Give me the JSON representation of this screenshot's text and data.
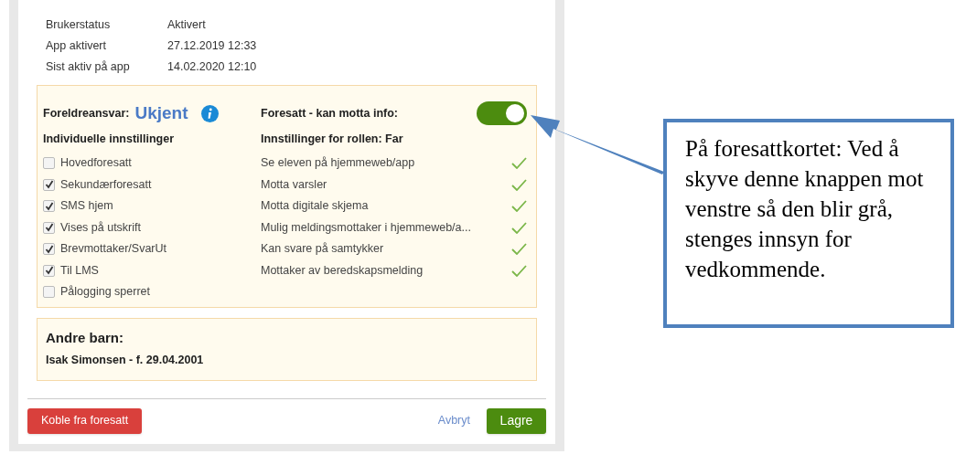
{
  "info_rows": [
    {
      "label": "Brukerstatus",
      "value": "Aktivert"
    },
    {
      "label": "App aktivert",
      "value": "27.12.2019 12:33"
    },
    {
      "label": "Sist aktiv på app",
      "value": "14.02.2020 12:10"
    }
  ],
  "guardian_panel": {
    "responsibility_label": "Foreldreansvar:",
    "responsibility_value": "Ukjent",
    "receive_info_label": "Foresatt - kan motta info:",
    "receive_info_on": true,
    "individual_heading": "Individuelle innstillinger",
    "role_heading": "Innstillinger for rollen: Far",
    "individual_settings": [
      {
        "label": "Hovedforesatt",
        "checked": false
      },
      {
        "label": "Sekundærforesatt",
        "checked": true
      },
      {
        "label": "SMS hjem",
        "checked": true
      },
      {
        "label": "Vises på utskrift",
        "checked": true
      },
      {
        "label": "Brevmottaker/SvarUt",
        "checked": true
      },
      {
        "label": "Til LMS",
        "checked": true
      },
      {
        "label": "Pålogging sperret",
        "checked": false
      }
    ],
    "role_settings": [
      {
        "label": "Se eleven på hjemmeweb/app",
        "allowed": true
      },
      {
        "label": "Motta varsler",
        "allowed": true
      },
      {
        "label": "Motta digitale skjema",
        "allowed": true
      },
      {
        "label": "Mulig meldingsmottaker i hjemmeweb/a...",
        "allowed": true
      },
      {
        "label": "Kan svare på samtykker",
        "allowed": true
      },
      {
        "label": "Mottaker av beredskapsmelding",
        "allowed": true
      }
    ]
  },
  "other_children": {
    "heading": "Andre barn:",
    "items": [
      "Isak Simonsen - f. 29.04.2001"
    ]
  },
  "footer": {
    "disconnect_button": "Koble fra foresatt",
    "cancel_link": "Avbryt",
    "save_button": "Lagre"
  },
  "callout": {
    "text": "På foresattkortet: Ved å skyve denne knappen mot venstre så den blir grå, stenges innsyn for vedkommende."
  }
}
